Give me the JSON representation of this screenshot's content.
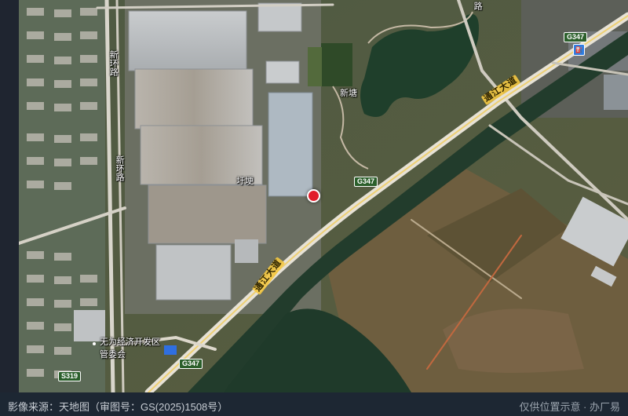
{
  "map": {
    "pin_color": "#e11d2a",
    "place_labels": {
      "xintang": "新塘",
      "yugeng": "圩埂",
      "admin_line1": "无为经济开发区",
      "admin_line2": "管委会"
    },
    "road_labels": {
      "top_road": "路",
      "west_road_upper": "新环路",
      "west_road_lower": "新环路",
      "tongjiang_upper": "通江大道",
      "tongjiang_lower": "通江大道"
    },
    "shields": {
      "g347_top": "G347",
      "g347_mid": "G347",
      "g347_bottom": "G347",
      "s319": "S319"
    },
    "icons": {
      "pin": "location-pin-icon",
      "fuel": "fuel-station-icon"
    }
  },
  "footer": {
    "source": "影像来源：天地图（审图号：GS(2025)1508号）",
    "disclaimer": "仅供位置示意 · 办厂易"
  }
}
